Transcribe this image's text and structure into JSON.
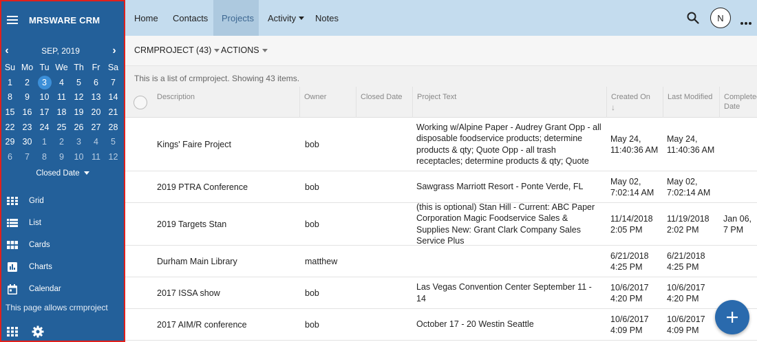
{
  "app": {
    "title": "MRSWARE CRM"
  },
  "calendar": {
    "month_label": "SEP, 2019",
    "weekdays": [
      "Su",
      "Mo",
      "Tu",
      "We",
      "Th",
      "Fr",
      "Sa"
    ],
    "weeks": [
      [
        "1",
        "2",
        "3",
        "4",
        "5",
        "6",
        "7"
      ],
      [
        "8",
        "9",
        "10",
        "11",
        "12",
        "13",
        "14"
      ],
      [
        "15",
        "16",
        "17",
        "18",
        "19",
        "20",
        "21"
      ],
      [
        "22",
        "23",
        "24",
        "25",
        "26",
        "27",
        "28"
      ],
      [
        "29",
        "30",
        "1",
        "2",
        "3",
        "4",
        "5"
      ],
      [
        "6",
        "7",
        "8",
        "9",
        "10",
        "11",
        "12"
      ]
    ],
    "today": "3",
    "filter_label": "Closed Date"
  },
  "sidebar": {
    "views": [
      {
        "label": "Grid",
        "icon": "grid-icon"
      },
      {
        "label": "List",
        "icon": "list-icon"
      },
      {
        "label": "Cards",
        "icon": "cards-icon"
      },
      {
        "label": "Charts",
        "icon": "bar-chart-icon"
      },
      {
        "label": "Calendar",
        "icon": "calendar-icon"
      }
    ],
    "note": "This page allows crmproject"
  },
  "topnav": {
    "tabs": [
      {
        "label": "Home",
        "active": false
      },
      {
        "label": "Contacts",
        "active": false
      },
      {
        "label": "Projects",
        "active": true
      },
      {
        "label": "Activity",
        "active": false,
        "dropdown": true
      },
      {
        "label": "Notes",
        "active": false
      }
    ],
    "avatar_initial": "N"
  },
  "toolbar": {
    "entity_label": "CRMPROJECT (43)",
    "actions_label": "ACTIONS"
  },
  "list_info": "This is a list of crmproject. Showing 43 items.",
  "table": {
    "columns": {
      "description": "Description",
      "owner": "Owner",
      "closed_date": "Closed Date",
      "project_text": "Project Text",
      "created_on": "Created On",
      "last_modified": "Last Modified",
      "completed_date": "Completed Date"
    },
    "rows": [
      {
        "description": "Kings' Faire Project",
        "owner": "bob",
        "closed_date": "",
        "project_text": "Working w/Alpine Paper - Audrey Grant Opp - all disposable foodservice products; determine products & qty; Quote Opp - all trash receptacles; determine products & qty; Quote",
        "created_on": "May 24, 11:40:36 AM",
        "last_modified": "May 24, 11:40:36 AM",
        "completed_date": ""
      },
      {
        "description": "2019 PTRA Conference",
        "owner": "bob",
        "closed_date": "",
        "project_text": "Sawgrass Marriott Resort - Ponte Verde, FL",
        "created_on": "May 02, 7:02:14 AM",
        "last_modified": "May 02, 7:02:14 AM",
        "completed_date": ""
      },
      {
        "description": "2019 Targets Stan",
        "owner": "bob",
        "closed_date": "",
        "project_text": "(this is optional)  Stan Hill -   Current:  ABC Paper Corporation Magic Foodservice Sales & Supplies New: Grant Clark Company Sales Service Plus",
        "created_on": "11/14/2018 2:05 PM",
        "last_modified": "11/19/2018 2:02 PM",
        "completed_date": "Jan 06, 7 PM"
      },
      {
        "description": "Durham Main Library",
        "owner": "matthew",
        "closed_date": "",
        "project_text": "",
        "created_on": "6/21/2018 4:25 PM",
        "last_modified": "6/21/2018 4:25 PM",
        "completed_date": ""
      },
      {
        "description": "2017 ISSA show",
        "owner": "bob",
        "closed_date": "",
        "project_text": "Las Vegas Convention Center September 11 - 14",
        "created_on": "10/6/2017 4:20 PM",
        "last_modified": "10/6/2017 4:20 PM",
        "completed_date": ""
      },
      {
        "description": "2017 AIM/R conference",
        "owner": "bob",
        "closed_date": "",
        "project_text": "October 17 - 20 Westin Seattle",
        "created_on": "10/6/2017 4:09 PM",
        "last_modified": "10/6/2017 4:09 PM",
        "completed_date": ""
      }
    ]
  },
  "colors": {
    "sidebar": "#23609a",
    "topbar": "#c4dcee",
    "active_tab": "#adc9df",
    "fab": "#2a6aad",
    "today": "#3c8fd8"
  }
}
